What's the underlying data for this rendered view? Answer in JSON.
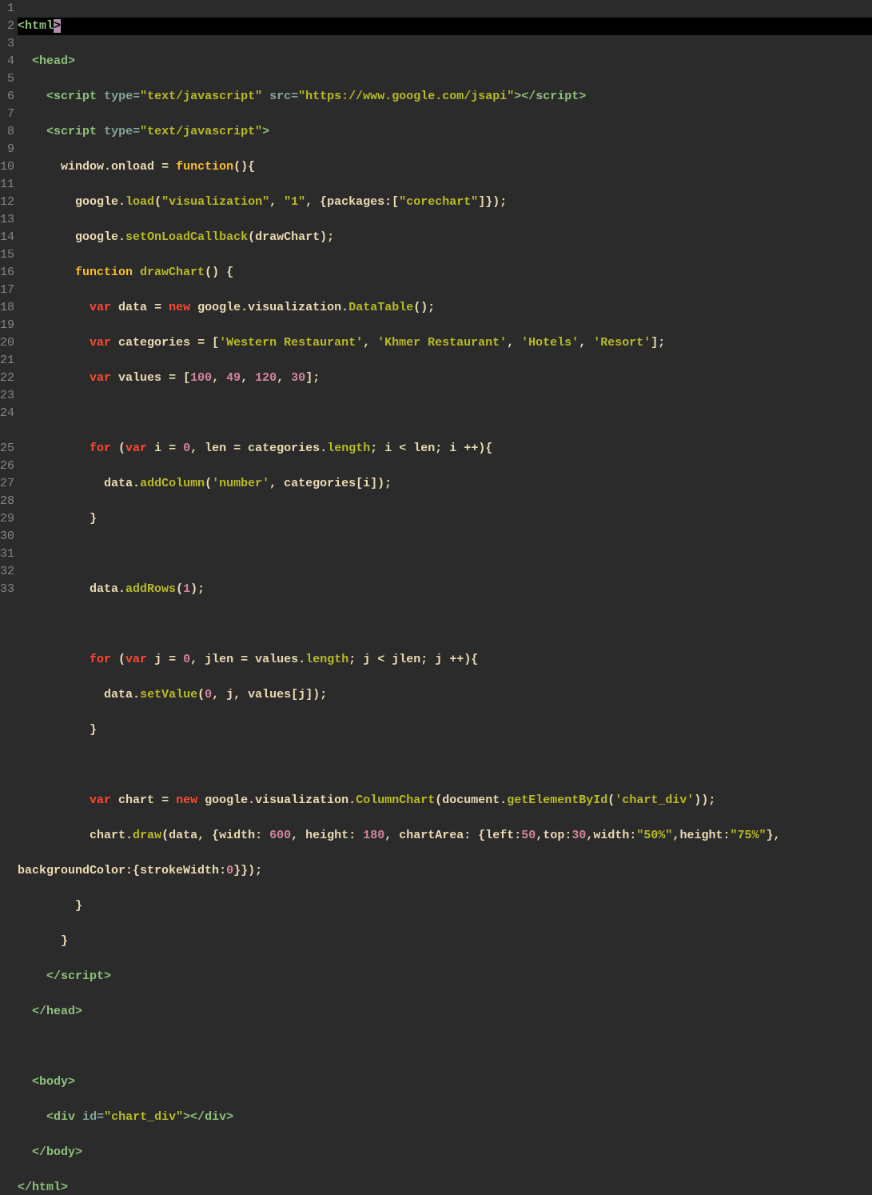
{
  "lines": {
    "count": 33,
    "current": 1
  },
  "code": {
    "l1_open": "<",
    "l1_tag": "html",
    "l1_cursor": ">",
    "l2_open": "  <",
    "l2_tag": "head",
    "l2_close": ">",
    "l3_indent": "    ",
    "l3_open": "<",
    "l3_tag": "script",
    "l3_sp": " ",
    "l3_attr1": "type",
    "l3_eq": "=",
    "l3_val1": "\"text/javascript\"",
    "l3_attr2": "src",
    "l3_val2": "\"https://www.google.com/jsapi\"",
    "l3_close": "></",
    "l3_tag2": "script",
    "l3_end": ">",
    "l4_indent": "    ",
    "l4_open": "<",
    "l4_tag": "script",
    "l4_attr": "type",
    "l4_val": "\"text/javascript\"",
    "l4_close": ">",
    "l5_indent": "      ",
    "l5_window": "window",
    "l5_dot": ".",
    "l5_onload": "onload",
    "l5_eq": " = ",
    "l5_func": "function",
    "l5_paren": "(){",
    "l6_indent": "        ",
    "l6_google": "google",
    "l6_load": "load",
    "l6_str1": "\"visualization\"",
    "l6_str2": "\"1\"",
    "l6_pkg": "packages",
    "l6_str3": "\"corechart\"",
    "l7_indent": "        ",
    "l7_google": "google",
    "l7_cb": "setOnLoadCallback",
    "l7_draw": "drawChart",
    "l8_indent": "        ",
    "l8_func": "function",
    "l8_name": "drawChart",
    "l9_indent": "          ",
    "l9_var": "var",
    "l9_data": "data",
    "l9_new": "new",
    "l9_google": "google",
    "l9_vis": "visualization",
    "l9_dt": "DataTable",
    "l10_indent": "          ",
    "l10_var": "var",
    "l10_cat": "categories",
    "l10_s1": "'Western Restaurant'",
    "l10_s2": "'Khmer Restaurant'",
    "l10_s3": "'Hotels'",
    "l10_s4": "'Resort'",
    "l11_indent": "          ",
    "l11_var": "var",
    "l11_val": "values",
    "l11_n1": "100",
    "l11_n2": "49",
    "l11_n3": "120",
    "l11_n4": "30",
    "l13_indent": "          ",
    "l13_for": "for",
    "l13_var": "var",
    "l13_i": "i",
    "l13_z": "0",
    "l13_len": "len",
    "l13_cat": "categories",
    "l13_length": "length",
    "l14_indent": "            ",
    "l14_data": "data",
    "l14_add": "addColumn",
    "l14_numstr": "'number'",
    "l14_cat": "categories",
    "l14_i": "i",
    "l15_indent": "          ",
    "l17_indent": "          ",
    "l17_data": "data",
    "l17_addrows": "addRows",
    "l17_one": "1",
    "l19_indent": "          ",
    "l19_for": "for",
    "l19_var": "var",
    "l19_j": "j",
    "l19_z": "0",
    "l19_jlen": "jlen",
    "l19_val": "values",
    "l19_length": "length",
    "l20_indent": "            ",
    "l20_data": "data",
    "l20_setval": "setValue",
    "l20_z": "0",
    "l20_j": "j",
    "l20_val": "values",
    "l21_indent": "          ",
    "l23_indent": "          ",
    "l23_var": "var",
    "l23_chart": "chart",
    "l23_new": "new",
    "l23_google": "google",
    "l23_vis": "visualization",
    "l23_cc": "ColumnChart",
    "l23_doc": "document",
    "l23_gebi": "getElementById",
    "l23_cd": "'chart_div'",
    "l24_indent": "          ",
    "l24_chart": "chart",
    "l24_draw": "draw",
    "l24_data": "data",
    "l24_width": "width",
    "l24_wn": "600",
    "l24_height": "height",
    "l24_hn": "180",
    "l24_ca": "chartArea",
    "l24_left": "left",
    "l24_ln": "50",
    "l24_top": "top",
    "l24_tn": "30",
    "l24_w2": "width",
    "l24_ws": "\"50%\"",
    "l24_h2": "height",
    "l24_hs": "\"75%\"",
    "l24b_bg": "backgroundColor",
    "l24b_sw": "strokeWidth",
    "l24b_z": "0",
    "l25_indent": "        ",
    "l26_indent": "      ",
    "l27_indent": "    ",
    "l27_tag": "script",
    "l28_indent": "  ",
    "l28_tag": "head",
    "l30_indent": "  ",
    "l30_tag": "body",
    "l31_indent": "    ",
    "l31_open": "<",
    "l31_tag": "div",
    "l31_attr": "id",
    "l31_val": "\"chart_div\"",
    "l31_mid": "></",
    "l31_tag2": "div",
    "l31_end": ">",
    "l32_indent": "  ",
    "l32_tag": "body",
    "l33_tag": "html"
  }
}
